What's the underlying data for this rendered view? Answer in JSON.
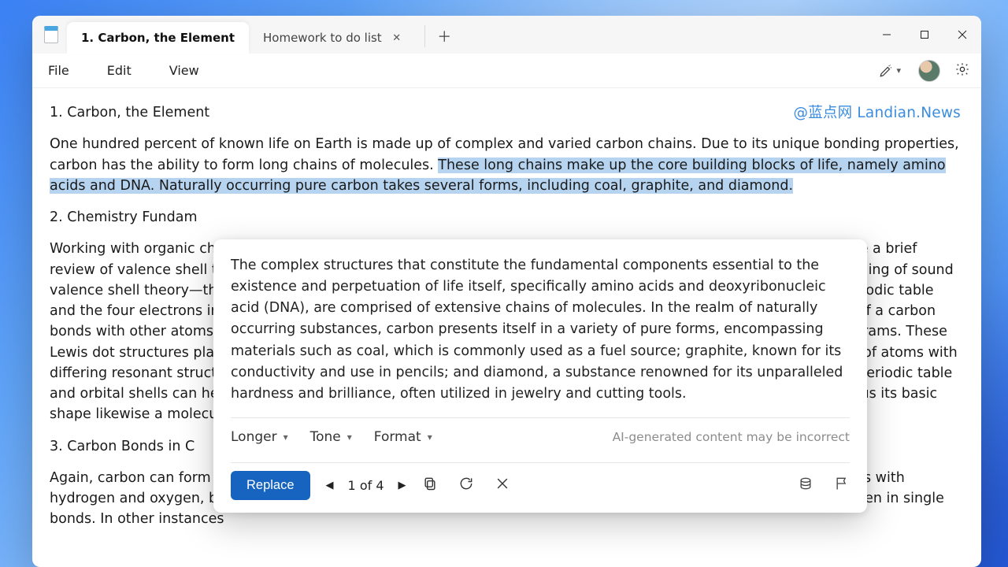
{
  "titlebar": {
    "tabs": [
      {
        "label": "1. Carbon, the Element",
        "active": true
      },
      {
        "label": "Homework to do list",
        "active": false
      }
    ]
  },
  "menu": {
    "file": "File",
    "edit": "Edit",
    "view": "View"
  },
  "watermark": "@蓝点网 Landian.News",
  "doc": {
    "h1": "1. Carbon, the Element",
    "p1a": "One hundred percent of known life on Earth is made up of complex and varied carbon chains. Due to its unique bonding properties, carbon has the ability to form long chains of molecules. ",
    "p1_sel": "These long chains make up the core building blocks of life, namely amino acids and DNA. Naturally occurring pure carbon takes several forms, including coal, graphite, and diamond.",
    "h2": "2. Chemistry Fundam",
    "p2": "Working with organic chemistry frequently involves looking at molecules' compositions and structures. We will provide a brief review of valence shell theory, Lewis dot diagrams, orbitals, and molecular shape. All of this starts with an understanding of sound valence shell theory—the idea that atoms want to have full outer electron shells. Carbon's particular place on the periodic table and the four electrons in its outer shell can help illuminate the eventual shape of a molecule. In short, the geometry of a carbon bonds with other atoms or molecules. Drawing each atom's valence shell becomes easiest when using Lewis dot diagrams. These Lewis dot structures play a pivotal role in determining the shape of a molecule. Carbon's atomic structure (and those of atoms with differing resonant structures) can help illuminate the eventual shape of a molecule. Carbon's particular place on the periodic table and orbital shells can help illuminate the eventual shape of a molecule. In short, the geometry of a molecule can tell us its basic shape likewise a molecule can tell us its basic shape",
    "h3": "3. Carbon Bonds in C",
    "p3": "Again, carbon can form up to four bonds with other molecules. In organic chemistry, we mainly focus on carbon chains with hydrogen and oxygen, but there are infinite possible compounds. In the simplest form, carbon bonds with four hydrogen in single bonds. In other instances"
  },
  "popover": {
    "text": "The complex structures that constitute the fundamental components essential to the existence and perpetuation of life itself, specifically amino acids and deoxyribonucleic acid (DNA), are comprised of extensive chains of molecules. In the realm of naturally occurring substances, carbon presents itself in a variety of pure forms, encompassing materials such as coal, which is commonly used as a fuel source; graphite, known for its conductivity and use in pencils; and diamond, a substance renowned for its unparalleled hardness and brilliance, often utilized in jewelry and cutting tools.",
    "options": {
      "longer": "Longer",
      "tone": "Tone",
      "format": "Format"
    },
    "disclaimer": "AI-generated content may be incorrect",
    "replace": "Replace",
    "pager": {
      "label": "1 of 4"
    }
  }
}
